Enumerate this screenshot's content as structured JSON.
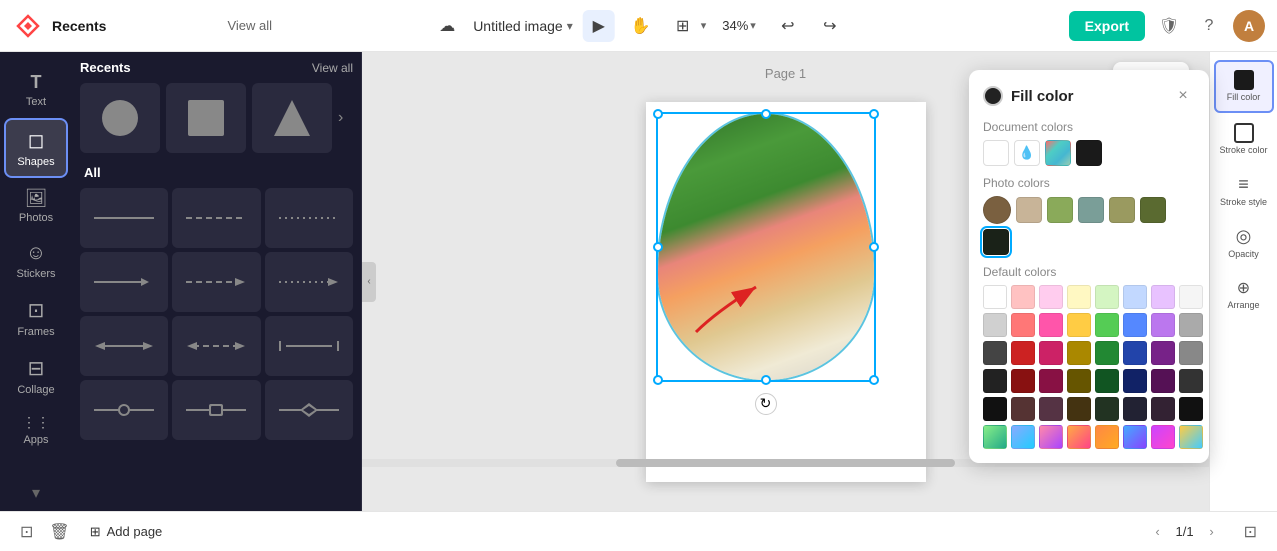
{
  "topbar": {
    "title": "Untitled image",
    "zoom": "34%",
    "export_label": "Export",
    "page_label": "Page 1",
    "recents_label": "Recents",
    "view_all_label": "View all",
    "add_page_label": "Add page",
    "page_counter": "1/1"
  },
  "sidebar": {
    "items": [
      {
        "id": "text",
        "label": "Text",
        "icon": "T"
      },
      {
        "id": "shapes",
        "label": "Shapes",
        "icon": "◻"
      },
      {
        "id": "photos",
        "label": "Photos",
        "icon": "⊞"
      },
      {
        "id": "stickers",
        "label": "Stickers",
        "icon": "☺"
      },
      {
        "id": "frames",
        "label": "Frames",
        "icon": "⊡"
      },
      {
        "id": "collage",
        "label": "Collage",
        "icon": "⊟"
      },
      {
        "id": "apps",
        "label": "Apps",
        "icon": "⋮⋮"
      }
    ]
  },
  "shapes_panel": {
    "all_label": "All"
  },
  "fill_color_panel": {
    "title": "Fill color",
    "close_label": "×",
    "doc_colors_label": "Document colors",
    "photo_colors_label": "Photo colors",
    "default_colors_label": "Default colors",
    "doc_colors": [
      "#ffffff",
      "eyedropper",
      "#gradient",
      "#1a1a1a"
    ],
    "photo_colors": [
      "#7a6a4a",
      "#c8b89a",
      "#8aaa68",
      "#7a9e9a",
      "#9a9a68",
      "#5a6a3a",
      "#1a2a1a"
    ],
    "default_colors_grid": [
      "#ffffff",
      "#ffc2c2",
      "#ffcfe8",
      "#fff8c2",
      "#d4f5c2",
      "#c2d8ff",
      "#e8c2ff",
      "#d0d0d0",
      "#ff8888",
      "#ff66b2",
      "#ffd966",
      "#66dd66",
      "#6699ff",
      "#cc88ff",
      "#333333",
      "#cc2222",
      "#cc2266",
      "#aa7700",
      "#228822",
      "#224499",
      "#882288",
      "#111111",
      "#881111",
      "#881144",
      "#665500",
      "#115511",
      "#112255",
      "#551155",
      "#222222",
      "#553333",
      "#553344",
      "#443311",
      "#223322",
      "#222233",
      "#332233",
      "#gradient1",
      "#gradient2",
      "#gradient3",
      "#gradient4",
      "#gradient5",
      "#gradient6",
      "#gradient7"
    ]
  },
  "right_toolbar": {
    "items": [
      {
        "id": "fill-color",
        "label": "Fill color",
        "icon": "■"
      },
      {
        "id": "stroke-color",
        "label": "Stroke color",
        "icon": "□"
      },
      {
        "id": "stroke-style",
        "label": "Stroke style",
        "icon": "≡"
      },
      {
        "id": "opacity",
        "label": "Opacity",
        "icon": "◎"
      },
      {
        "id": "arrange",
        "label": "Arrange",
        "icon": "⊕"
      }
    ]
  },
  "canvas_toolbar": {
    "copy_icon": "⊡",
    "more_icon": "•••"
  },
  "colors": {
    "accent": "#00c4a0",
    "selection": "#00aaff",
    "active_border": "#6c8ff5"
  }
}
